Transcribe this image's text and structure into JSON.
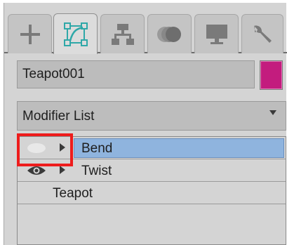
{
  "tabs": [
    {
      "name": "create",
      "icon": "plus-icon"
    },
    {
      "name": "modify",
      "icon": "modify-curve-icon",
      "active": true
    },
    {
      "name": "hierarchy",
      "icon": "hierarchy-icon"
    },
    {
      "name": "motion",
      "icon": "motion-icon"
    },
    {
      "name": "display",
      "icon": "display-monitor-icon"
    },
    {
      "name": "utilities",
      "icon": "wrench-icon"
    }
  ],
  "object": {
    "name": "Teapot001",
    "color": "#c31c7e"
  },
  "modifier_list": {
    "selected": "Modifier List"
  },
  "stack": {
    "items": [
      {
        "label": "Bend",
        "icon": "eye-icon",
        "visible": false,
        "selected": true
      },
      {
        "label": "Twist",
        "icon": "eye-icon",
        "visible": true,
        "selected": false
      },
      {
        "label": "Teapot",
        "selected": false
      }
    ]
  },
  "colors": {
    "accent_highlight": "#8fb4de",
    "annotation_box": "#ee1c1c",
    "active_tab_icon": "#2fa8a8"
  }
}
